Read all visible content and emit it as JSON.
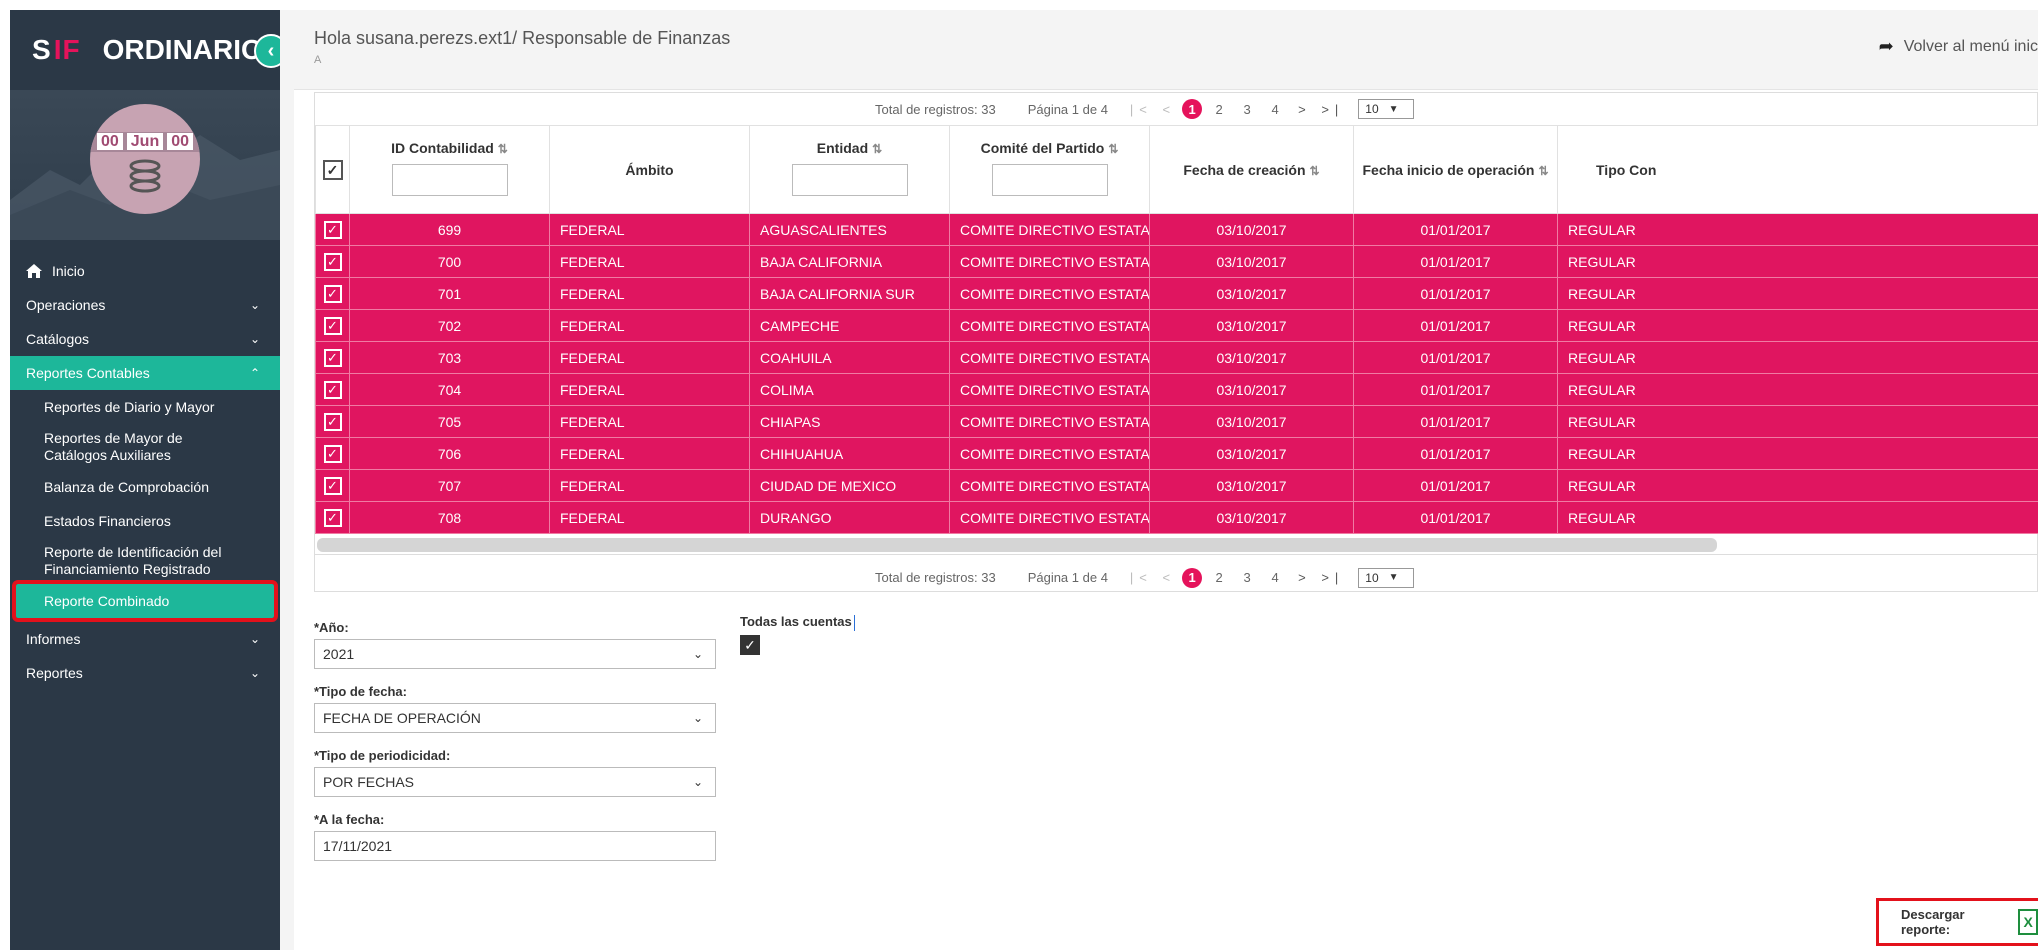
{
  "app": {
    "logo_s": "S",
    "logo_if": "IF",
    "title": "ORDINARIO",
    "collapse_icon": "chevron-left-icon"
  },
  "profile": {
    "badge_left": "00",
    "badge_mid": "Jun",
    "badge_right": "00"
  },
  "sidebar": {
    "items": [
      {
        "label": "Inicio"
      },
      {
        "label": "Operaciones"
      },
      {
        "label": "Catálogos"
      },
      {
        "label": "Reportes Contables"
      },
      {
        "label": "Informes"
      },
      {
        "label": "Reportes"
      }
    ],
    "reportes_contables_sub": [
      {
        "label": "Reportes de Diario y Mayor"
      },
      {
        "label": "Reportes de Mayor de Catálogos Auxiliares"
      },
      {
        "label": "Balanza de Comprobación"
      },
      {
        "label": "Estados Financieros"
      },
      {
        "label": "Reporte de Identificación del Financiamiento Registrado"
      },
      {
        "label": "Reporte Combinado"
      }
    ]
  },
  "header": {
    "greeting": "Hola susana.perezs.ext1/ Responsable de Finanzas",
    "greeting_sub": "A",
    "back_link": "Volver al menú inic"
  },
  "pager": {
    "total": "Total de registros: 33",
    "page_info": "Página 1 de 4",
    "first_prev": "|< <",
    "pages": [
      "1",
      "2",
      "3",
      "4"
    ],
    "current_page": "1",
    "next_last": "> >|",
    "page_size": "10"
  },
  "table": {
    "headers": {
      "id": "ID Contabilidad",
      "ambito": "Ámbito",
      "entidad": "Entidad",
      "comite": "Comité del Partido",
      "fecha_creacion": "Fecha de creación",
      "fecha_inicio": "Fecha inicio de operación",
      "tipo": "Tipo Con"
    },
    "rows": [
      {
        "id": "699",
        "ambito": "FEDERAL",
        "entidad": "AGUASCALIENTES",
        "comite": "COMITE DIRECTIVO ESTATAL",
        "fecha_creacion": "03/10/2017",
        "fecha_inicio": "01/01/2017",
        "tipo": "REGULAR"
      },
      {
        "id": "700",
        "ambito": "FEDERAL",
        "entidad": "BAJA CALIFORNIA",
        "comite": "COMITE DIRECTIVO ESTATAL",
        "fecha_creacion": "03/10/2017",
        "fecha_inicio": "01/01/2017",
        "tipo": "REGULAR"
      },
      {
        "id": "701",
        "ambito": "FEDERAL",
        "entidad": "BAJA CALIFORNIA SUR",
        "comite": "COMITE DIRECTIVO ESTATAL",
        "fecha_creacion": "03/10/2017",
        "fecha_inicio": "01/01/2017",
        "tipo": "REGULAR"
      },
      {
        "id": "702",
        "ambito": "FEDERAL",
        "entidad": "CAMPECHE",
        "comite": "COMITE DIRECTIVO ESTATAL",
        "fecha_creacion": "03/10/2017",
        "fecha_inicio": "01/01/2017",
        "tipo": "REGULAR"
      },
      {
        "id": "703",
        "ambito": "FEDERAL",
        "entidad": "COAHUILA",
        "comite": "COMITE DIRECTIVO ESTATAL",
        "fecha_creacion": "03/10/2017",
        "fecha_inicio": "01/01/2017",
        "tipo": "REGULAR"
      },
      {
        "id": "704",
        "ambito": "FEDERAL",
        "entidad": "COLIMA",
        "comite": "COMITE DIRECTIVO ESTATAL",
        "fecha_creacion": "03/10/2017",
        "fecha_inicio": "01/01/2017",
        "tipo": "REGULAR"
      },
      {
        "id": "705",
        "ambito": "FEDERAL",
        "entidad": "CHIAPAS",
        "comite": "COMITE DIRECTIVO ESTATAL",
        "fecha_creacion": "03/10/2017",
        "fecha_inicio": "01/01/2017",
        "tipo": "REGULAR"
      },
      {
        "id": "706",
        "ambito": "FEDERAL",
        "entidad": "CHIHUAHUA",
        "comite": "COMITE DIRECTIVO ESTATAL",
        "fecha_creacion": "03/10/2017",
        "fecha_inicio": "01/01/2017",
        "tipo": "REGULAR"
      },
      {
        "id": "707",
        "ambito": "FEDERAL",
        "entidad": "CIUDAD DE MEXICO",
        "comite": "COMITE DIRECTIVO ESTATAL",
        "fecha_creacion": "03/10/2017",
        "fecha_inicio": "01/01/2017",
        "tipo": "REGULAR"
      },
      {
        "id": "708",
        "ambito": "FEDERAL",
        "entidad": "DURANGO",
        "comite": "COMITE DIRECTIVO ESTATAL",
        "fecha_creacion": "03/10/2017",
        "fecha_inicio": "01/01/2017",
        "tipo": "REGULAR"
      }
    ]
  },
  "form": {
    "anio_label": "*Año:",
    "anio_value": "2021",
    "todas_label": "Todas las cuentas",
    "todas_checked": true,
    "tipo_fecha_label": "*Tipo de fecha:",
    "tipo_fecha_value": "FECHA DE OPERACIÓN",
    "periodicidad_label": "*Tipo de periodicidad:",
    "periodicidad_value": "POR FECHAS",
    "a_la_fecha_label": "*A la fecha:",
    "a_la_fecha_value": "17/11/2021"
  },
  "download": {
    "label": "Descargar reporte:",
    "icon": "excel-file-icon",
    "icon_text": "X"
  },
  "colors": {
    "sidebar_bg": "#2b3846",
    "accent_green": "#1db79a",
    "row_pink": "#e01560",
    "highlight_red": "#e3111b"
  }
}
